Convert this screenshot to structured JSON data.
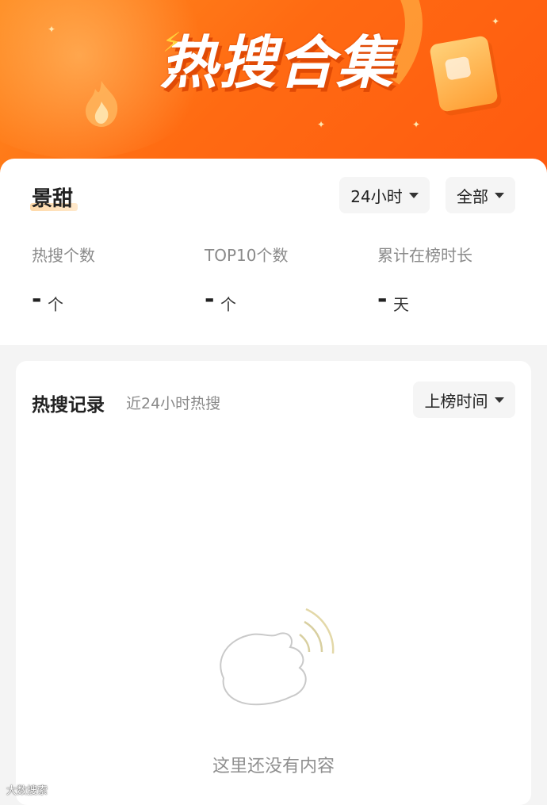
{
  "banner": {
    "title": "热搜合集",
    "flame_icon": "flame-icon",
    "bolt_icon": "lightning-bolt-icon",
    "doc_icon": "document-icon"
  },
  "profile": {
    "name": "景甜"
  },
  "filters": {
    "time_range": "24小时",
    "category": "全部"
  },
  "stats": [
    {
      "label": "热搜个数",
      "value": "-",
      "unit": "个"
    },
    {
      "label": "TOP10个数",
      "value": "-",
      "unit": "个"
    },
    {
      "label": "累计在榜时长",
      "value": "-",
      "unit": "天"
    }
  ],
  "records": {
    "title": "热搜记录",
    "subtitle": "近24小时热搜",
    "sort_label": "上榜时间",
    "empty_icon": "empty-hand-wave-icon",
    "empty_text": "这里还没有内容"
  },
  "watermark": {
    "text": "大数搜索"
  },
  "colors": {
    "brand_orange": "#ff6a12",
    "accent_highlight": "#ffd9a8"
  }
}
